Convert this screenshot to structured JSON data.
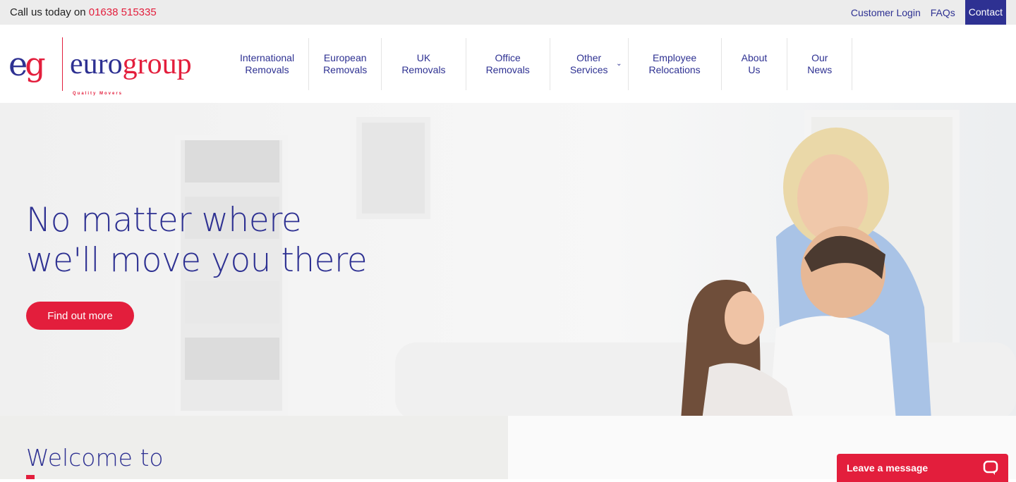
{
  "topbar": {
    "call_prefix": "Call us today on",
    "phone": "01638 515335",
    "links": [
      "Customer Login",
      "FAQs"
    ],
    "contact": "Contact"
  },
  "logo": {
    "monogram_e": "e",
    "monogram_g": "g",
    "word_euro": "euro",
    "word_group": "group",
    "tagline": "Quality Movers"
  },
  "nav": [
    {
      "l1": "International",
      "l2": "Removals"
    },
    {
      "l1": "European",
      "l2": "Removals"
    },
    {
      "l1": "UK",
      "l2": "Removals"
    },
    {
      "l1": "Office",
      "l2": "Removals"
    },
    {
      "l1": "Other",
      "l2": "Services",
      "dropdown": true
    },
    {
      "l1": "Employee",
      "l2": "Relocations"
    },
    {
      "l1": "About",
      "l2": "Us"
    },
    {
      "l1": "Our",
      "l2": "News"
    }
  ],
  "hero": {
    "line1": "No matter where",
    "line2": "we'll move you there",
    "button": "Find out more"
  },
  "welcome": {
    "title": "Welcome to"
  },
  "chat": {
    "label": "Leave a message",
    "icon": "chat-bubble-icon"
  },
  "colors": {
    "navy": "#2e3192",
    "red": "#e31e3c"
  }
}
